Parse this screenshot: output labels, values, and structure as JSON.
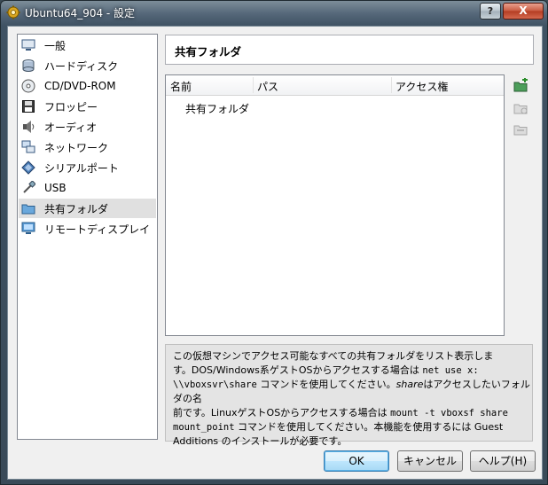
{
  "window": {
    "title": "Ubuntu64_904 - 設定",
    "help_glyph": "?",
    "close_glyph": "X"
  },
  "nav": {
    "items": [
      {
        "label": "一般",
        "icon": "monitor-icon"
      },
      {
        "label": "ハードディスク",
        "icon": "harddisk-icon"
      },
      {
        "label": "CD/DVD-ROM",
        "icon": "cd-icon"
      },
      {
        "label": "フロッピー",
        "icon": "floppy-icon"
      },
      {
        "label": "オーディオ",
        "icon": "audio-icon"
      },
      {
        "label": "ネットワーク",
        "icon": "network-icon"
      },
      {
        "label": "シリアルポート",
        "icon": "serial-port-icon"
      },
      {
        "label": "USB",
        "icon": "usb-icon"
      },
      {
        "label": "共有フォルダ",
        "icon": "folder-icon",
        "selected": true
      },
      {
        "label": "リモートディスプレイ",
        "icon": "remote-display-icon"
      }
    ]
  },
  "page": {
    "title": "共有フォルダ"
  },
  "table": {
    "columns": [
      "名前",
      "パス",
      "アクセス権"
    ],
    "group_row": "共有フォルダ"
  },
  "description": {
    "t1": "この仮想マシンでアクセス可能なすべての共有フォルダをリスト表示しま",
    "t2": "す。DOS/Windows系ゲストOSからアクセスする場合は",
    "m1": "net use x:",
    "m2": "\\\\vboxsvr\\share",
    "t3": "コマンドを使用してください。",
    "i1": "share",
    "t4": "はアクセスしたいフォルダの名",
    "t5": "前です。LinuxゲストOSからアクセスする場合は",
    "m3": "mount -t vboxsf share",
    "m4": "mount_point",
    "t6": "コマンドを使用してください。本機能を使用するには Guest",
    "t7": "Additions のインストールが必要です。"
  },
  "buttons": {
    "ok": "OK",
    "cancel": "キャンセル",
    "help": "ヘルプ(H)"
  },
  "colors": {
    "selection": "#e0e0e0",
    "ok_border": "#3c7fb1"
  }
}
